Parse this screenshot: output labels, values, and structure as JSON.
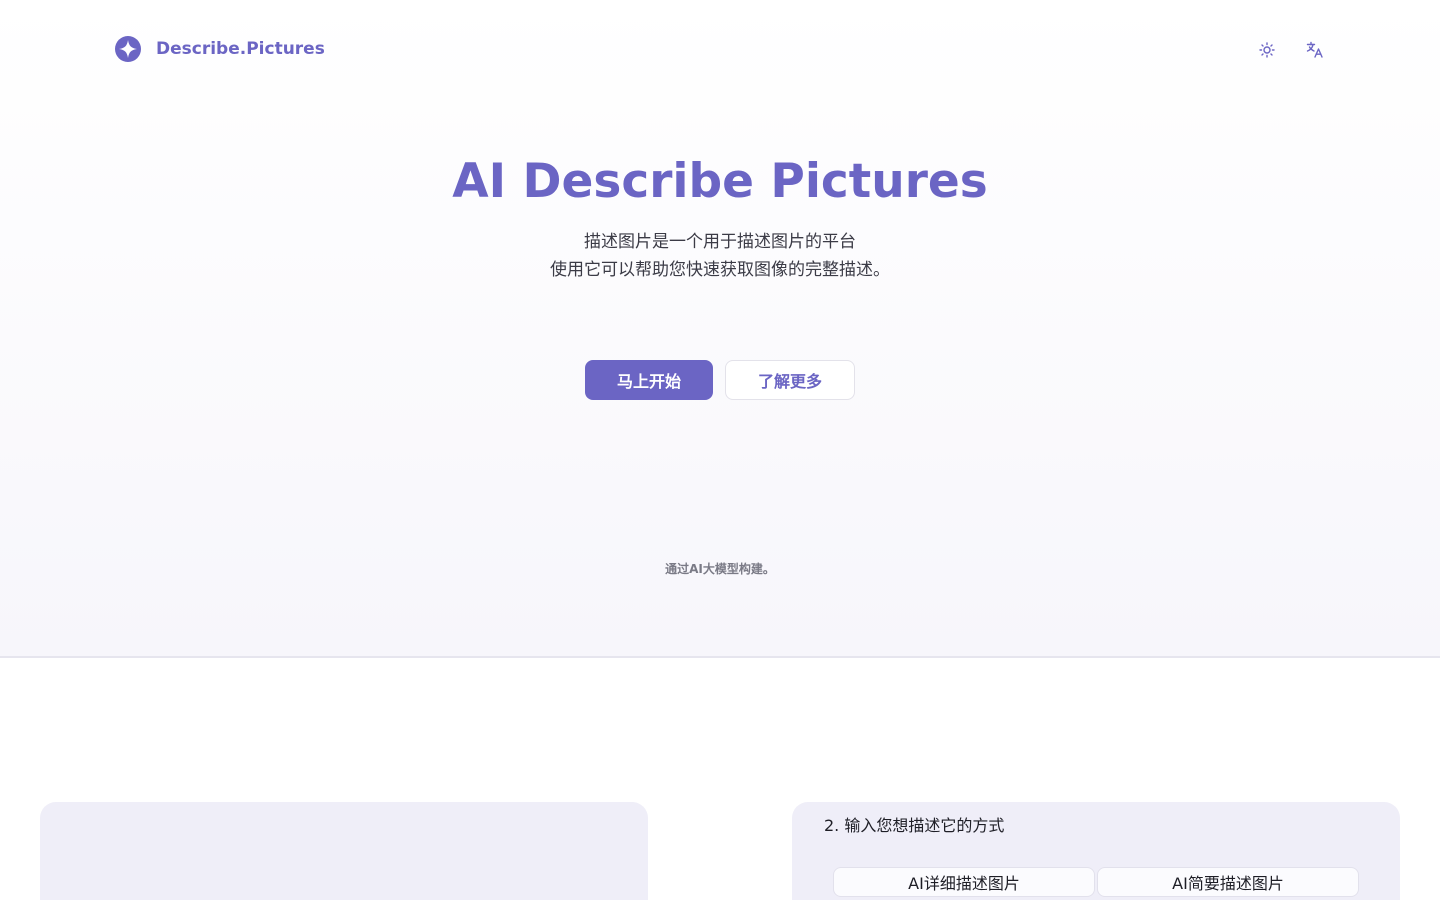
{
  "header": {
    "brand_name": "Describe.Pictures",
    "brand_icon": "sparkle-logo-icon",
    "theme_toggle_icon": "sun-icon",
    "language_icon": "translate-icon"
  },
  "hero": {
    "title": "AI Describe Pictures",
    "subtitle_line1": "描述图片是一个用于描述图片的平台",
    "subtitle_line2": "使用它可以帮助您快速获取图像的完整描述。",
    "primary_button": "马上开始",
    "secondary_button": "了解更多",
    "built_with": "通过AI大模型构建。"
  },
  "tool": {
    "step2_label": "2. 输入您想描述它的方式",
    "options": [
      "AI详细描述图片",
      "AI简要描述图片"
    ]
  },
  "colors": {
    "accent": "#6b65c4",
    "panel_bg": "#efeef8"
  }
}
